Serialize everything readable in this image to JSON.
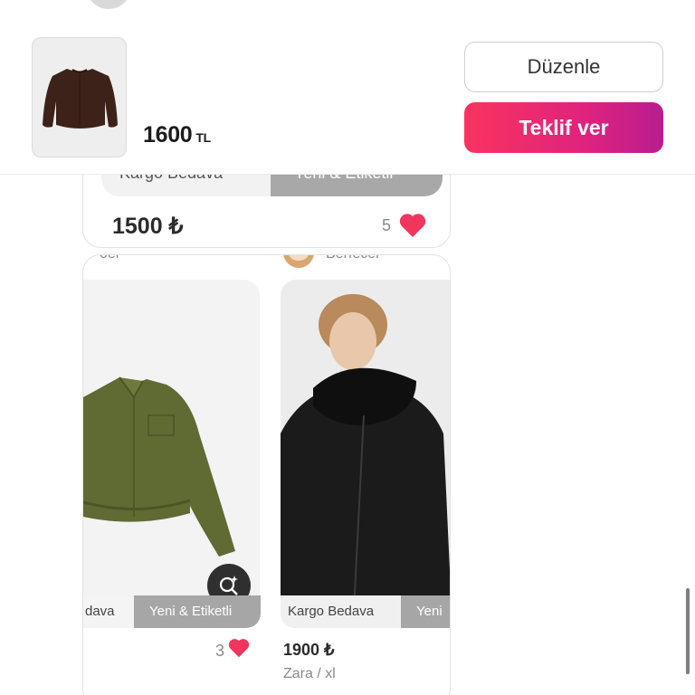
{
  "top_bar": {
    "price_value": "1600",
    "price_currency": "TL",
    "edit_label": "Düzenle",
    "offer_label": "Teklif ver",
    "offer_gradient": [
      "#f9335f",
      "#b81d8f"
    ]
  },
  "listings": [
    {
      "tags": [
        "Kargo Bedava",
        "Yeni & Etiketli"
      ],
      "price": "1500 ₺",
      "likes": "5"
    },
    {
      "seller_fragment": "oer",
      "tags": [
        "dava",
        "Yeni & Etiketli"
      ],
      "likes": "3",
      "image": "green suede jacket"
    },
    {
      "seller_fragment": "Berfecer",
      "tags": [
        "Kargo Bedava",
        "Yeni"
      ],
      "price": "1900 ₺",
      "brand_size": "Zara / xl",
      "image": "woman in black leather jacket with shearling collar"
    }
  ],
  "icons": {
    "heart": "heart-icon",
    "zoom": "visual-search-icon"
  },
  "colors": {
    "heart": "#f0365c",
    "tag_gray": "#a6a6a6"
  }
}
